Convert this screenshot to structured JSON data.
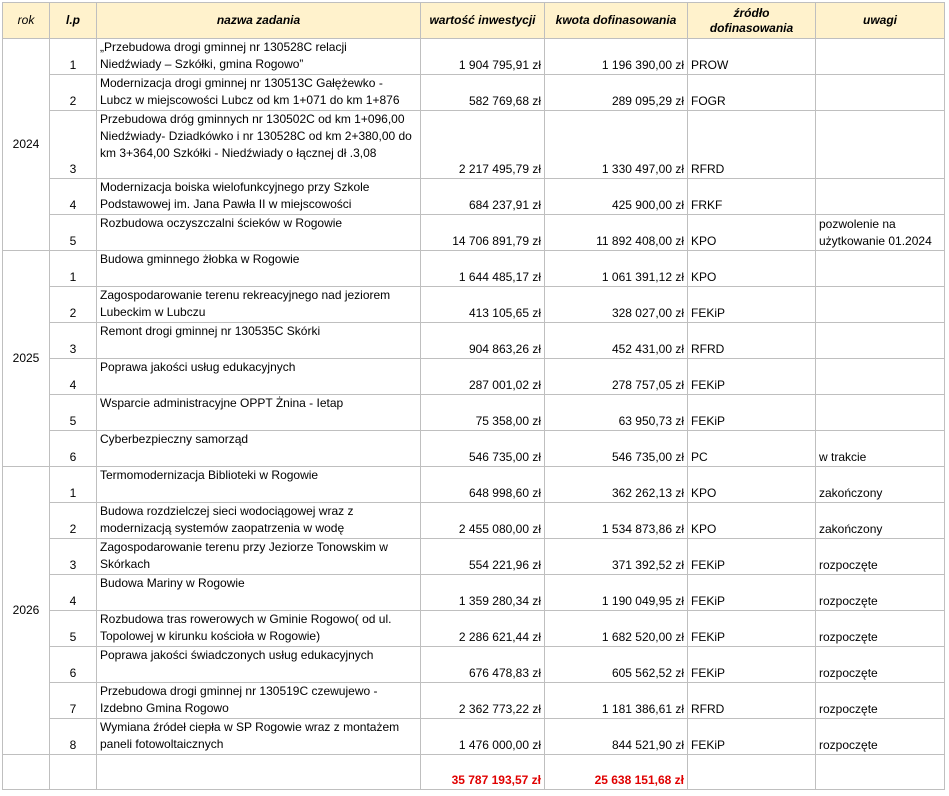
{
  "headers": {
    "rok": "rok",
    "lp": "l.p",
    "name": "nazwa zadania",
    "inv": "wartość inwestycji",
    "fund": "kwota dofinasowania",
    "src": "źródło dofinasowania",
    "note": "uwagi"
  },
  "rows": [
    {
      "year": "2024",
      "lp": "1",
      "name": [
        "„Przebudowa drogi gminnej nr 130528C relacji",
        "Niedźwiady – Szkółki, gmina Rogowo”"
      ],
      "inv": "1 904 795,91 zł",
      "fund": "1 196 390,00 zł",
      "src": "PROW",
      "note": ""
    },
    {
      "year": "",
      "lp": "2",
      "name": [
        "Modernizacja drogi gminnej nr 130513C Gałężewko -",
        "Lubcz w miejscowości Lubcz od km 1+071 do km 1+876"
      ],
      "inv": "582 769,68 zł",
      "fund": "289 095,29 zł",
      "src": "FOGR",
      "note": ""
    },
    {
      "year": "",
      "lp": "3",
      "name": [
        "Przebudowa dróg gminnych nr 130502C od km 1+096,00",
        "Niedźwiady- Dziadkówko i nr 130528C od km 2+380,00 do",
        "km 3+364,00 Szkółki - Niedźwiady o łącznej dł .3,08"
      ],
      "inv": "2 217 495,79 zł",
      "fund": "1 330 497,00 zł",
      "src": "RFRD",
      "note": ""
    },
    {
      "year": "",
      "lp": "4",
      "name": [
        "Modernizacja boiska wielofunkcyjnego przy Szkole",
        "Podstawowej im. Jana Pawła II w miejscowości"
      ],
      "inv": "684 237,91 zł",
      "fund": "425 900,00 zł",
      "src": "FRKF",
      "note": ""
    },
    {
      "year": "",
      "lp": "5",
      "name": [
        "Rozbudowa oczyszczalni ścieków w Rogowie"
      ],
      "inv": "14 706 891,79 zł",
      "fund": "11 892 408,00 zł",
      "src": "KPO",
      "note": "pozwolenie na użytkowanie 01.2024"
    },
    {
      "year": "2025",
      "lp": "1",
      "name": [
        "Budowa gminnego żłobka w Rogowie"
      ],
      "inv": "1 644 485,17 zł",
      "fund": "1 061 391,12 zł",
      "src": "KPO",
      "note": ""
    },
    {
      "year": "",
      "lp": "2",
      "name": [
        "Zagospodarowanie terenu rekreacyjnego nad jeziorem",
        "Lubeckim w Lubczu"
      ],
      "inv": "413 105,65 zł",
      "fund": "328 027,00 zł",
      "src": "FEKiP",
      "note": ""
    },
    {
      "year": "",
      "lp": "3",
      "name": [
        "Remont drogi gminnej nr 130535C Skórki"
      ],
      "inv": "904 863,26 zł",
      "fund": "452 431,00 zł",
      "src": "RFRD",
      "note": ""
    },
    {
      "year": "",
      "lp": "4",
      "name": [
        "Poprawa jakości usług edukacyjnych"
      ],
      "inv": "287 001,02 zł",
      "fund": "278 757,05 zł",
      "src": "FEKiP",
      "note": ""
    },
    {
      "year": "",
      "lp": "5",
      "name": [
        "Wsparcie administracyjne OPPT Żnina - Ietap"
      ],
      "inv": "75 358,00 zł",
      "fund": "63 950,73 zł",
      "src": "FEKiP",
      "note": ""
    },
    {
      "year": "",
      "lp": "6",
      "name": [
        "Cyberbezpieczny samorząd"
      ],
      "inv": "546 735,00 zł",
      "fund": "546 735,00 zł",
      "src": "PC",
      "note": "w trakcie"
    },
    {
      "year": "2026",
      "lp": "1",
      "name": [
        "Termomodernizacja Biblioteki w Rogowie"
      ],
      "inv": "648 998,60 zł",
      "fund": "362 262,13 zł",
      "src": "KPO",
      "note": "zakończony"
    },
    {
      "year": "",
      "lp": "2",
      "name": [
        "Budowa rozdzielczej sieci wodociągowej wraz z",
        "modernizacją systemów zaopatrzenia w wodę"
      ],
      "inv": "2 455 080,00 zł",
      "fund": "1 534 873,86 zł",
      "src": "KPO",
      "note": "zakończony"
    },
    {
      "year": "",
      "lp": "3",
      "name": [
        "Zagospodarowanie terenu przy Jeziorze Tonowskim w",
        "Skórkach"
      ],
      "inv": "554 221,96 zł",
      "fund": "371 392,52 zł",
      "src": "FEKiP",
      "note": "rozpoczęte"
    },
    {
      "year": "",
      "lp": "4",
      "name": [
        "Budowa Mariny w Rogowie"
      ],
      "inv": "1 359 280,34 zł",
      "fund": "1 190 049,95 zł",
      "src": "FEKiP",
      "note": "rozpoczęte"
    },
    {
      "year": "",
      "lp": "5",
      "name": [
        "Rozbudowa tras rowerowych w Gminie Rogowo( od ul.",
        "Topolowej w kirunku kościoła w Rogowie)"
      ],
      "inv": "2 286 621,44 zł",
      "fund": "1 682 520,00 zł",
      "src": "FEKiP",
      "note": "rozpoczęte"
    },
    {
      "year": "",
      "lp": "6",
      "name": [
        "Poprawa jakości świadczonych usług edukacyjnych"
      ],
      "inv": "676 478,83 zł",
      "fund": "605 562,52 zł",
      "src": "FEKiP",
      "note": "rozpoczęte"
    },
    {
      "year": "",
      "lp": "7",
      "name": [
        "Przebudowa drogi gminnej nr 130519C czewujewo -",
        "Izdebno Gmina Rogowo"
      ],
      "inv": "2 362 773,22 zł",
      "fund": "1 181 386,61 zł",
      "src": "RFRD",
      "note": "rozpoczęte"
    },
    {
      "year": "",
      "lp": "8",
      "name": [
        "Wymiana źródeł ciepła w SP Rogowie wraz z montażem",
        "paneli fotowoltaicznych"
      ],
      "inv": "1 476 000,00 zł",
      "fund": "844 521,90 zł",
      "src": "FEKiP",
      "note": "rozpoczęte"
    }
  ],
  "totals": {
    "inv": "35 787 193,57 zł",
    "fund": "25 638 151,68 zł"
  }
}
